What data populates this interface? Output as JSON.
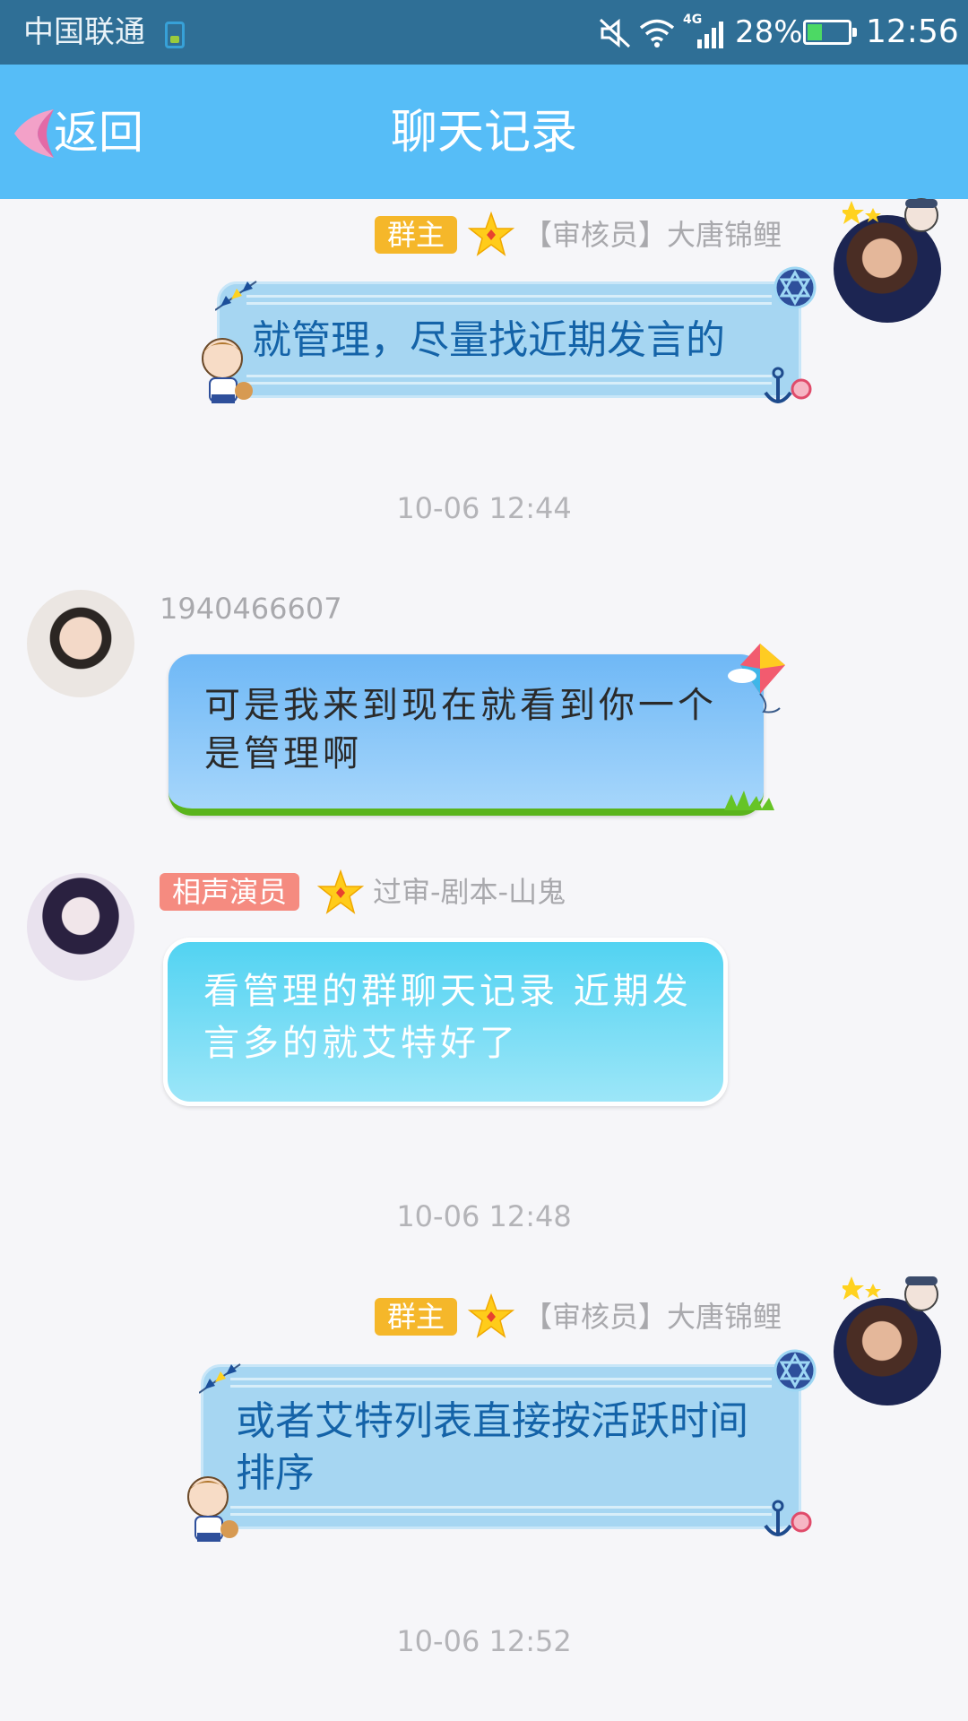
{
  "status_bar": {
    "carrier": "中国联通",
    "network": "4G",
    "battery": "28%",
    "time": "12:56"
  },
  "header": {
    "back_label": "返回",
    "title": "聊天记录"
  },
  "messages": [
    {
      "side": "right",
      "badge": "群主",
      "sender": "【审核员】大唐锦鲤",
      "text": "就管理，尽量找近期发言的"
    },
    {
      "timestamp": "10-06 12:44"
    },
    {
      "side": "left",
      "sender": "1940466607",
      "text": "可是我来到现在就看到你一个是管理啊"
    },
    {
      "side": "left",
      "badge": "相声演员",
      "sender": "过审-剧本-山鬼",
      "text": "看管理的群聊天记录 近期发言多的就艾特好了"
    },
    {
      "timestamp": "10-06 12:48"
    },
    {
      "side": "right",
      "badge": "群主",
      "sender": "【审核员】大唐锦鲤",
      "text": "或者艾特列表直接按活跃时间排序"
    },
    {
      "timestamp": "10-06 12:52"
    }
  ],
  "colors": {
    "status_bar": "#2f6f96",
    "title_bar": "#56bdf7",
    "badge_owner": "#f5b72a",
    "badge_title": "#f58b80",
    "background": "#f6f6f9"
  }
}
